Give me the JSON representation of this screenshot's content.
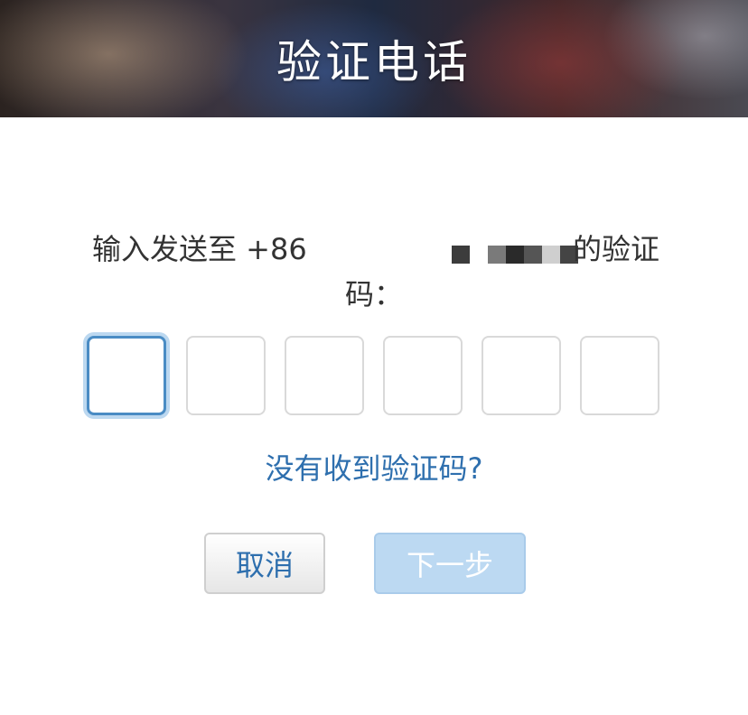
{
  "header": {
    "title": "验证电话"
  },
  "prompt": {
    "prefix": "输入发送至 +86",
    "suffix": "的验证",
    "line2": "码："
  },
  "code_inputs": {
    "count": 6,
    "active_index": 0
  },
  "resend_link": "没有收到验证码?",
  "buttons": {
    "cancel": "取消",
    "next": "下一步"
  },
  "colors": {
    "accent": "#2e6fae",
    "active_border": "#4a8cc4",
    "disabled_button": "#bcd9f2"
  }
}
